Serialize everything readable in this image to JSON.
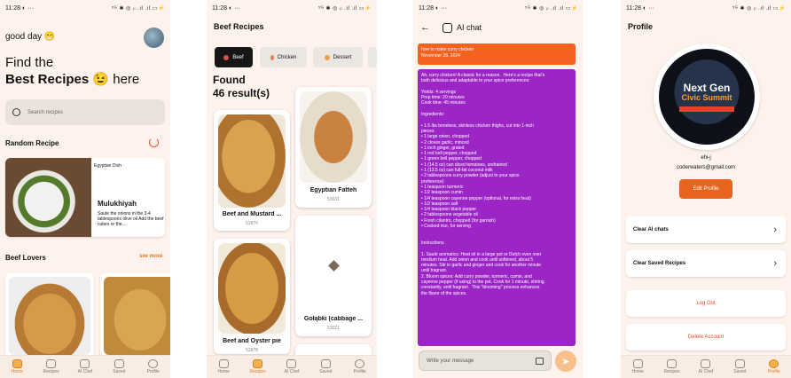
{
  "status": {
    "time": "11:28",
    "time_extra": "◐ ···",
    "icons": "⁵ᴳ ✱ ◎ ᵢₗ .ıl .ıl ▭⚡"
  },
  "nav": {
    "home": "Home",
    "recipes": "Recipes",
    "aichef": "AI Chef",
    "saved": "Saved",
    "profile": "Profile"
  },
  "home": {
    "greeting": "good day 😁",
    "headline_line1": "Find the",
    "headline_bold": "Best Recipes 😉",
    "headline_tail": "here",
    "search_placeholder": "Search recipes",
    "random_title": "Random Recipe",
    "random": {
      "category": "Egyptian Dish",
      "name": "Mulukhiyah",
      "desc": "Saute the onions in the 3-4 tablespoons olive oil Add the beef cubes or the..."
    },
    "lovers_title": "Beef Lovers",
    "see_more": "see more"
  },
  "recipes": {
    "title": "Beef Recipes",
    "tabs": [
      "Beef",
      "Chicken",
      "Dessert"
    ],
    "found_label": "Found",
    "count_label": "46 result(s)",
    "cards": [
      {
        "name": "Beef and Mustard ...",
        "id": "52874"
      },
      {
        "name": "Egyptian Fatteh",
        "id": "53031"
      },
      {
        "name": "Beef and Oyster pie",
        "id": "52878"
      },
      {
        "name": "Gołąbki (cabbage ...",
        "id": "53021"
      }
    ]
  },
  "chat": {
    "title": "AI chat",
    "question": "how to make curry chicken",
    "date": "November 28, 2024",
    "answer_lines": [
      "Ah, curry chicken! A classic for a reason.  Here's a recipe that's",
      "both delicious and adaptable to your spice preferences:",
      "",
      "Yields: 4 servings",
      "Prep time: 20 minutes",
      "Cook time: 45 minutes",
      "",
      "Ingredients:",
      "",
      "• 1.5 lbs boneless, skinless chicken thighs, cut into 1-inch",
      "pieces",
      "• 1 large onion, chopped",
      "• 2 cloves garlic, minced",
      "• 1 inch ginger, grated",
      "• 1 red bell pepper, chopped",
      "• 1 green bell pepper, chopped",
      "• 1 (14.5 oz) can diced tomatoes, undrained",
      "• 1 (13.5 oz) can full-fat coconut milk",
      "• 2 tablespoons curry powder (adjust to your spice",
      "preference)",
      "• 1 teaspoon turmeric",
      "• 1/2 teaspoon cumin",
      "• 1/4 teaspoon cayenne pepper (optional, for extra heat)",
      "• 1/2 teaspoon salt",
      "• 1/4 teaspoon black pepper",
      "• 2 tablespoons vegetable oil",
      "• Fresh cilantro, chopped (for garnish)",
      "• Cooked rice, for serving",
      "",
      "",
      "Instructions",
      "",
      "1. Sauté aromatics: Heat oil in a large pot or Dutch oven over",
      "medium heat. Add onion and cook until softened, about 5",
      "minutes. Stir in garlic and ginger and cook for another minute",
      "until fragrant.",
      "2. Bloom spices: Add curry powder, turmeric, cumin, and",
      "cayenne pepper (if using) to the pot. Cook for 1 minute, stirring",
      "constantly, until fragrant.  This \"blooming\" process enhances",
      "the flavor of the spices."
    ],
    "input_placeholder": "Write your message",
    "send_icon": "send-icon"
  },
  "profile": {
    "title": "Profile",
    "logo_line1": "Next Gen",
    "logo_line2": "Civic Summit",
    "name": "ehi-j",
    "email": "coderwaters@gmail.com",
    "edit_label": "Edit Profile",
    "rows": [
      "Clear AI chats",
      "Clear Saved Recipes"
    ],
    "logout": "Log Out",
    "delete": "Delete Account"
  }
}
